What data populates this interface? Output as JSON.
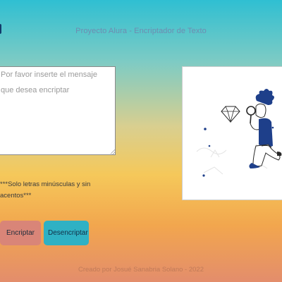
{
  "header": {
    "title": "Proyecto Alura - Encriptador de Texto"
  },
  "input": {
    "placeholder": "Por favor inserte el mensaje que desea encriptar",
    "value": ""
  },
  "warning": {
    "text": "***Solo letras minúsculas y sin acentos***"
  },
  "buttons": {
    "encrypt_label": "Encriptar",
    "decrypt_label": "Desencriptar"
  },
  "output": {
    "illustration": "person-with-magnifying-glass-and-diamond-illustration"
  },
  "footer": {
    "text": "Creado por Josué Sanabria Solano - 2022"
  },
  "colors": {
    "encrypt_button": "#d98578",
    "decrypt_button": "#2fb1c4",
    "title_text": "#6f8cb0",
    "illustration_accent": "#1e3f8a"
  }
}
